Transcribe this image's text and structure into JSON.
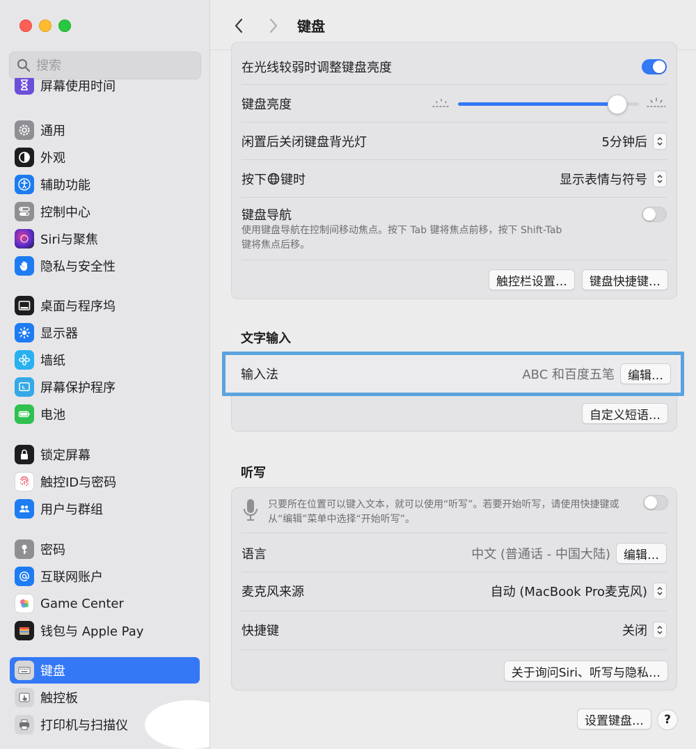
{
  "window": {
    "title": "键盘"
  },
  "search": {
    "placeholder": "搜索"
  },
  "sidebar": {
    "items": [
      {
        "label": "屏幕使用时间",
        "icon": "hourglass-icon"
      },
      {
        "label": "通用",
        "icon": "gear-icon"
      },
      {
        "label": "外观",
        "icon": "appearance-icon"
      },
      {
        "label": "辅助功能",
        "icon": "accessibility-icon"
      },
      {
        "label": "控制中心",
        "icon": "control-center-icon"
      },
      {
        "label": "Siri与聚焦",
        "icon": "siri-icon"
      },
      {
        "label": "隐私与安全性",
        "icon": "hand-icon"
      },
      {
        "label": "桌面与程序坞",
        "icon": "dock-icon"
      },
      {
        "label": "显示器",
        "icon": "sun-icon"
      },
      {
        "label": "墙纸",
        "icon": "flower-icon"
      },
      {
        "label": "屏幕保护程序",
        "icon": "screensaver-icon"
      },
      {
        "label": "电池",
        "icon": "battery-icon"
      },
      {
        "label": "锁定屏幕",
        "icon": "lock-icon"
      },
      {
        "label": "触控ID与密码",
        "icon": "fingerprint-icon"
      },
      {
        "label": "用户与群组",
        "icon": "users-icon"
      },
      {
        "label": "密码",
        "icon": "key-icon"
      },
      {
        "label": "互联网账户",
        "icon": "at-icon"
      },
      {
        "label": "Game Center",
        "icon": "game-center-icon"
      },
      {
        "label": "钱包与 Apple Pay",
        "icon": "wallet-icon"
      },
      {
        "label": "键盘",
        "icon": "keyboard-icon",
        "active": true
      },
      {
        "label": "触控板",
        "icon": "trackpad-icon"
      },
      {
        "label": "打印机与扫描仪",
        "icon": "printer-icon"
      }
    ]
  },
  "keyboard": {
    "adjust_brightness_label": "在光线较弱时调整键盘亮度",
    "adjust_brightness_on": true,
    "brightness_label": "键盘亮度",
    "brightness_level": 0.88,
    "backlight_off_label": "闲置后关闭键盘背光灯",
    "backlight_off_value": "5分钟后",
    "globe_label_before": "按下",
    "globe_label_after": "键时",
    "globe_value": "显示表情与符号",
    "nav_label": "键盘导航",
    "nav_desc_line1": "使用键盘导航在控制间移动焦点。按下 Tab 键将焦点前移，按下 Shift-Tab",
    "nav_desc_line2": "键将焦点后移。",
    "nav_on": false,
    "touchbar_button": "触控栏设置…",
    "shortcuts_button": "键盘快捷键…"
  },
  "text_input": {
    "section_title": "文字输入",
    "input_method_label": "输入法",
    "input_method_value": "ABC 和百度五笔",
    "edit_button": "编辑…",
    "custom_phrase_button": "自定义短语…"
  },
  "dictation": {
    "section_title": "听写",
    "desc_line1": "只要所在位置可以键入文本，就可以使用“听写”。若要开始听写，请使用快捷键或",
    "desc_line2": "从“编辑”菜单中选择“开始听写”。",
    "dictation_on": false,
    "language_label": "语言",
    "language_value": "中文 (普通话 - 中国大陆)",
    "language_edit_button": "编辑…",
    "mic_label": "麦克风来源",
    "mic_value": "自动 (MacBook Pro麦克风)",
    "shortcut_label": "快捷键",
    "shortcut_value": "关闭",
    "about_button": "关于询问Siri、听写与隐私…"
  },
  "footer": {
    "setup_button": "设置键盘…",
    "help_label": "?"
  },
  "colors": {
    "accent": "#3478f6",
    "highlight": "#5ba3dd"
  }
}
